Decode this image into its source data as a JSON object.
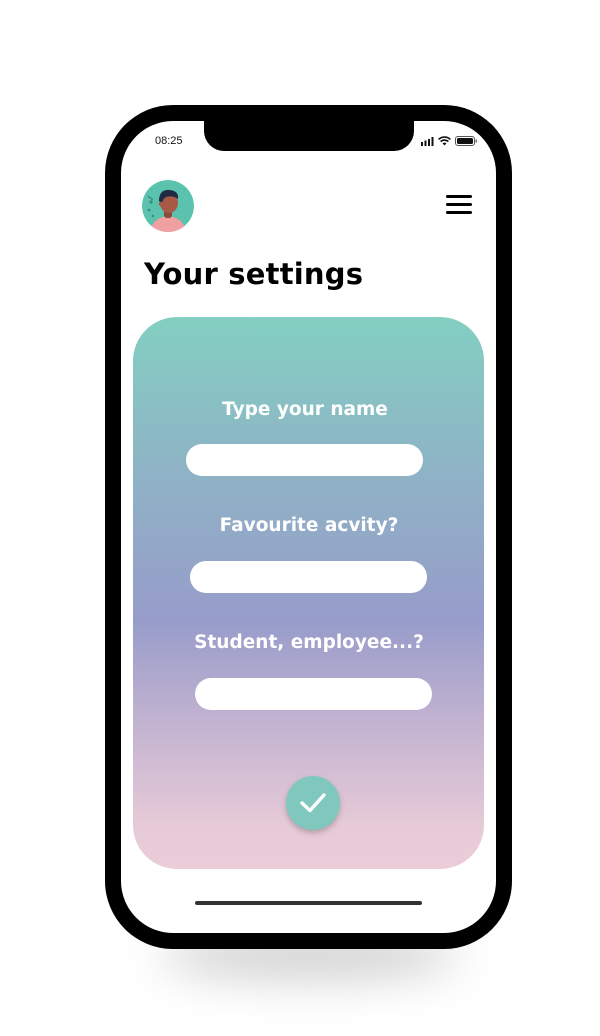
{
  "status_bar": {
    "time": "08:25"
  },
  "header": {
    "avatar_icon": "user-avatar-icon",
    "menu_icon": "hamburger-menu-icon",
    "title": "Your settings"
  },
  "form": {
    "fields": [
      {
        "label": "Type your name",
        "value": "",
        "placeholder": ""
      },
      {
        "label": "Favourite acvity?",
        "value": "",
        "placeholder": ""
      },
      {
        "label": "Student, employee...?",
        "value": "",
        "placeholder": ""
      }
    ],
    "submit_icon": "check-icon"
  },
  "colors": {
    "gradient_top": "#83cfc1",
    "gradient_middle": "#979cca",
    "gradient_bottom": "#ebcdd8",
    "submit_button": "#80c7bd",
    "phone_frame": "#000000"
  }
}
